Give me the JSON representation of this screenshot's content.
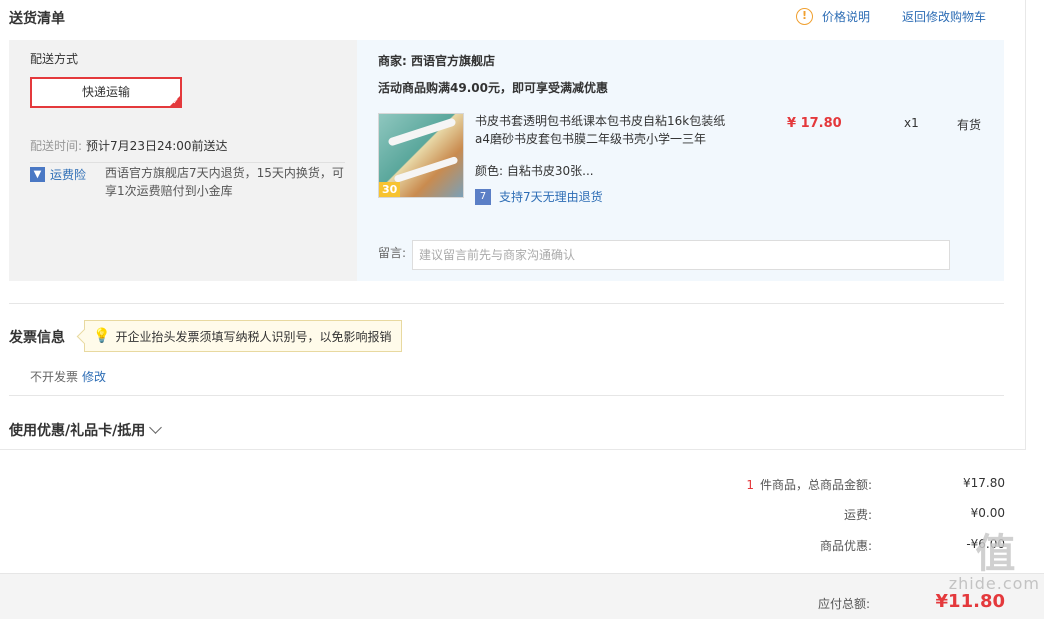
{
  "section_title": "送货清单",
  "top_links": {
    "price_info": "价格说明",
    "back_to_cart": "返回修改购物车"
  },
  "shipping": {
    "method_label": "配送方式",
    "option": "快递运输",
    "time_label": "配送时间:",
    "time_value": "预计7月23日24:00前送达",
    "insurance_label": "运费险",
    "insurance_text": "西语官方旗舰店7天内退货，15天内换货，可享1次运费赔付到小金库"
  },
  "order": {
    "merchant": "商家: 西语官方旗舰店",
    "promo": "活动商品购满49.00元，即可享受满减优惠",
    "product": {
      "image_badge": "30",
      "title": "书皮书套透明包书纸课本包书皮自粘16k包装纸a4磨砂书皮套包书膜二年级书壳小学一三年",
      "price": "¥ 17.80",
      "qty": "x1",
      "stock": "有货",
      "color_label": "颜色:",
      "color_value": "自粘书皮30张...",
      "return_policy": "支持7天无理由退货"
    },
    "note_label": "留言:",
    "note_placeholder": "建议留言前先与商家沟通确认"
  },
  "invoice": {
    "title": "发票信息",
    "tip": "开企业抬头发票须填写纳税人识别号，以免影响报销",
    "status": "不开发票",
    "edit": "修改"
  },
  "coupon": {
    "title": "使用优惠/礼品卡/抵用"
  },
  "summary": {
    "item_count": "1",
    "goods_label": "件商品，总商品金额:",
    "goods_value": "¥17.80",
    "shipping_label": "运费:",
    "shipping_value": "¥0.00",
    "discount_label": "商品优惠:",
    "discount_value": "-¥6.00",
    "pay_label": "应付总额:",
    "pay_total": "¥11.80"
  },
  "watermark": {
    "logo": "值",
    "text": "zhide.com"
  },
  "colors": {
    "accent_red": "#e4393c",
    "link_blue": "#2d6db5",
    "panel_gray": "#f2f2f2",
    "panel_blue": "#f2f8fd"
  }
}
